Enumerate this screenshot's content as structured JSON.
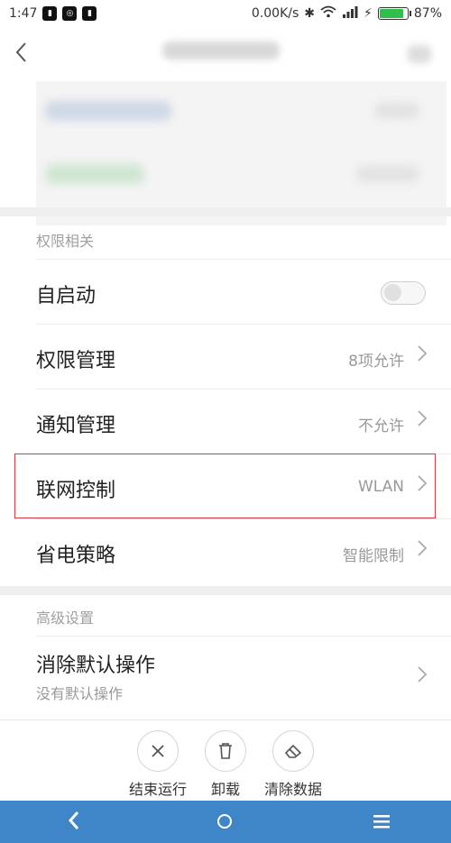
{
  "status_bar": {
    "time": "1:47",
    "speed": "0.00K/s",
    "battery_percent": "87%",
    "battery_level": 0.87
  },
  "sections": {
    "permissions_title": "权限相关",
    "advanced_title": "高级设置"
  },
  "rows": {
    "autostart": {
      "label": "自启动",
      "enabled": false
    },
    "permission_mgmt": {
      "label": "权限管理",
      "value": "8项允许"
    },
    "notification_mgmt": {
      "label": "通知管理",
      "value": "不允许"
    },
    "network_control": {
      "label": "联网控制",
      "value": "WLAN"
    },
    "power_policy": {
      "label": "省电策略",
      "value": "智能限制"
    },
    "clear_defaults": {
      "label": "消除默认操作",
      "sub": "没有默认操作"
    }
  },
  "actions": {
    "stop": "结束运行",
    "uninstall": "卸载",
    "clear_data": "清除数据"
  },
  "icons": {
    "back": "chevron-left-icon",
    "chevron": "chevron-right-icon",
    "stop": "close-icon",
    "uninstall": "trash-icon",
    "clear": "eraser-icon"
  },
  "colors": {
    "navbar": "#3f86c9",
    "highlight": "#e0363f",
    "battery": "#2fbf4a"
  }
}
